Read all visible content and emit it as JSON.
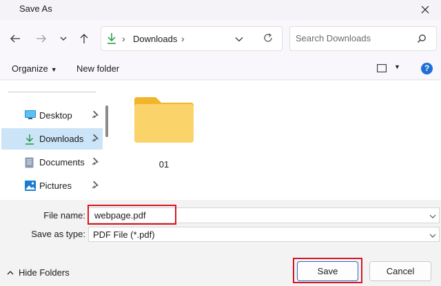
{
  "window": {
    "title": "Save As"
  },
  "address": {
    "current_folder": "Downloads",
    "search_placeholder": "Search Downloads"
  },
  "commands": {
    "organize": "Organize",
    "new_folder": "New folder"
  },
  "nav_items": [
    {
      "label": "Desktop",
      "icon": "desktop-icon",
      "selected": false
    },
    {
      "label": "Downloads",
      "icon": "download-arrow-icon",
      "selected": true
    },
    {
      "label": "Documents",
      "icon": "document-icon",
      "selected": false
    },
    {
      "label": "Pictures",
      "icon": "pictures-icon",
      "selected": false
    }
  ],
  "content": {
    "folders": [
      {
        "name": "01",
        "icon": "folder-icon"
      }
    ]
  },
  "form": {
    "file_name_label": "File name:",
    "file_name_value": "webpage.pdf",
    "save_type_label": "Save as type:",
    "save_type_value": "PDF File (*.pdf)"
  },
  "footer": {
    "hide_folders": "Hide Folders",
    "save": "Save",
    "cancel": "Cancel"
  },
  "colors": {
    "accent": "#1f6fd6",
    "selection": "#cce4f7",
    "highlight": "#d8141e",
    "folder": "#f7c948"
  }
}
